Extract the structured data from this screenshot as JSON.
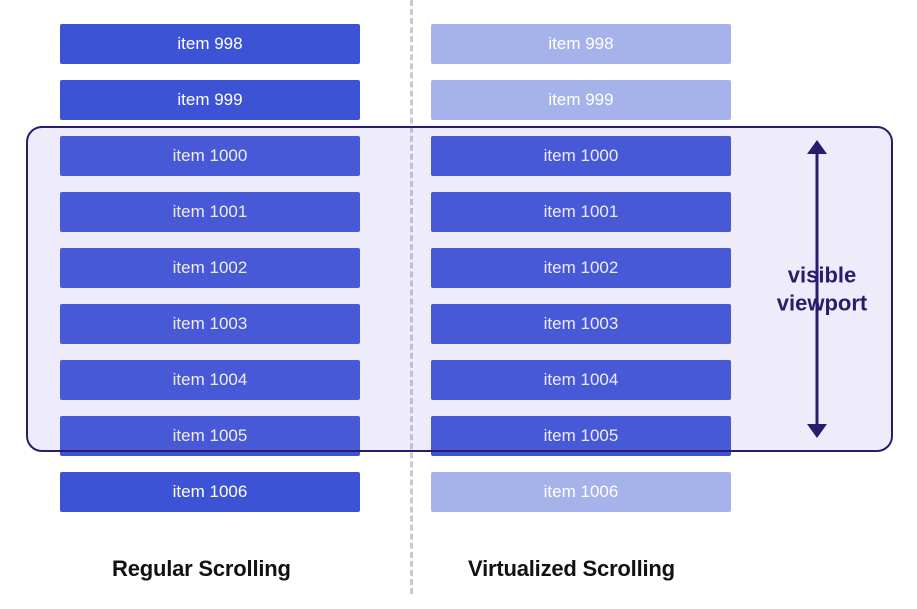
{
  "colors": {
    "item_solid": "#3d53d6",
    "item_faded": "#a6b3ea",
    "viewport_border": "#2a1c6d",
    "divider": "#c9c9cf"
  },
  "viewport": {
    "label_line1": "visible",
    "label_line2": "viewport"
  },
  "left": {
    "caption": "Regular Scrolling",
    "items": [
      {
        "label": "item 998",
        "faded": false
      },
      {
        "label": "item 999",
        "faded": false
      },
      {
        "label": "item 1000",
        "faded": false
      },
      {
        "label": "item 1001",
        "faded": false
      },
      {
        "label": "item 1002",
        "faded": false
      },
      {
        "label": "item 1003",
        "faded": false
      },
      {
        "label": "item 1004",
        "faded": false
      },
      {
        "label": "item 1005",
        "faded": false
      },
      {
        "label": "item 1006",
        "faded": false
      }
    ]
  },
  "right": {
    "caption": "Virtualized Scrolling",
    "items": [
      {
        "label": "item 998",
        "faded": true
      },
      {
        "label": "item 999",
        "faded": true
      },
      {
        "label": "item 1000",
        "faded": false
      },
      {
        "label": "item 1001",
        "faded": false
      },
      {
        "label": "item 1002",
        "faded": false
      },
      {
        "label": "item 1003",
        "faded": false
      },
      {
        "label": "item 1004",
        "faded": false
      },
      {
        "label": "item 1005",
        "faded": false
      },
      {
        "label": "item 1006",
        "faded": true
      }
    ]
  }
}
